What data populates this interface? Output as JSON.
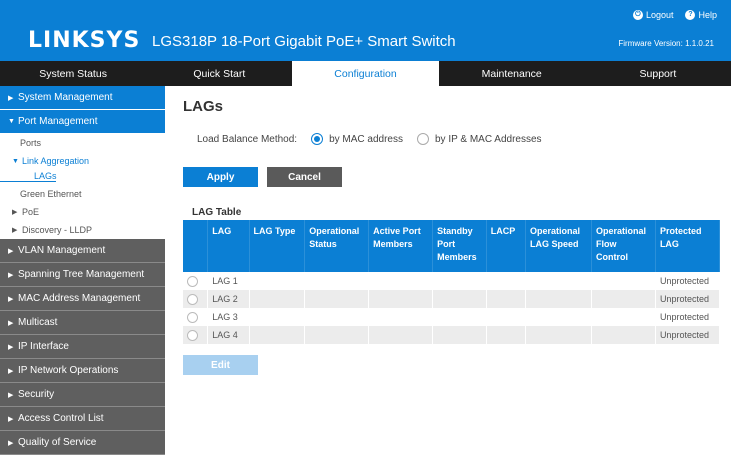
{
  "header": {
    "logo": "LINKSYS",
    "product": "LGS318P 18-Port Gigabit PoE+ Smart Switch",
    "logout": "Logout",
    "help": "Help",
    "firmware": "Firmware Version: 1.1.0.21"
  },
  "nav": [
    "System Status",
    "Quick Start",
    "Configuration",
    "Maintenance",
    "Support"
  ],
  "sidebar": {
    "system_management": "System Management",
    "port_management": "Port Management",
    "ports": "Ports",
    "link_aggregation": "Link Aggregation",
    "lags": "LAGs",
    "green_ethernet": "Green Ethernet",
    "poe": "PoE",
    "discovery": "Discovery - LLDP",
    "dark_items": [
      "VLAN Management",
      "Spanning Tree Management",
      "MAC Address Management",
      "Multicast",
      "IP Interface",
      "IP Network Operations",
      "Security",
      "Access Control List",
      "Quality of Service"
    ]
  },
  "main": {
    "title": "LAGs",
    "load_balance_label": "Load Balance Method:",
    "option_mac": "by MAC address",
    "option_ip": "by IP & MAC Addresses",
    "apply": "Apply",
    "cancel": "Cancel",
    "table_title": "LAG Table",
    "columns": [
      "",
      "LAG",
      "LAG Type",
      "Operational Status",
      "Active Port Members",
      "Standby Port Members",
      "LACP",
      "Operational LAG Speed",
      "Operational Flow Control",
      "Protected LAG"
    ],
    "rows": [
      {
        "lag": "LAG 1",
        "protected": "Unprotected"
      },
      {
        "lag": "LAG 2",
        "protected": "Unprotected"
      },
      {
        "lag": "LAG 3",
        "protected": "Unprotected"
      },
      {
        "lag": "LAG 4",
        "protected": "Unprotected"
      }
    ],
    "edit": "Edit"
  },
  "colors": {
    "brand_blue": "#0b7fd4",
    "nav_dark": "#1d1d1d",
    "sidebar_dark": "#5f5f5f"
  },
  "icons": [
    "power-icon",
    "help-icon",
    "triangle-right-icon",
    "triangle-down-icon"
  ]
}
